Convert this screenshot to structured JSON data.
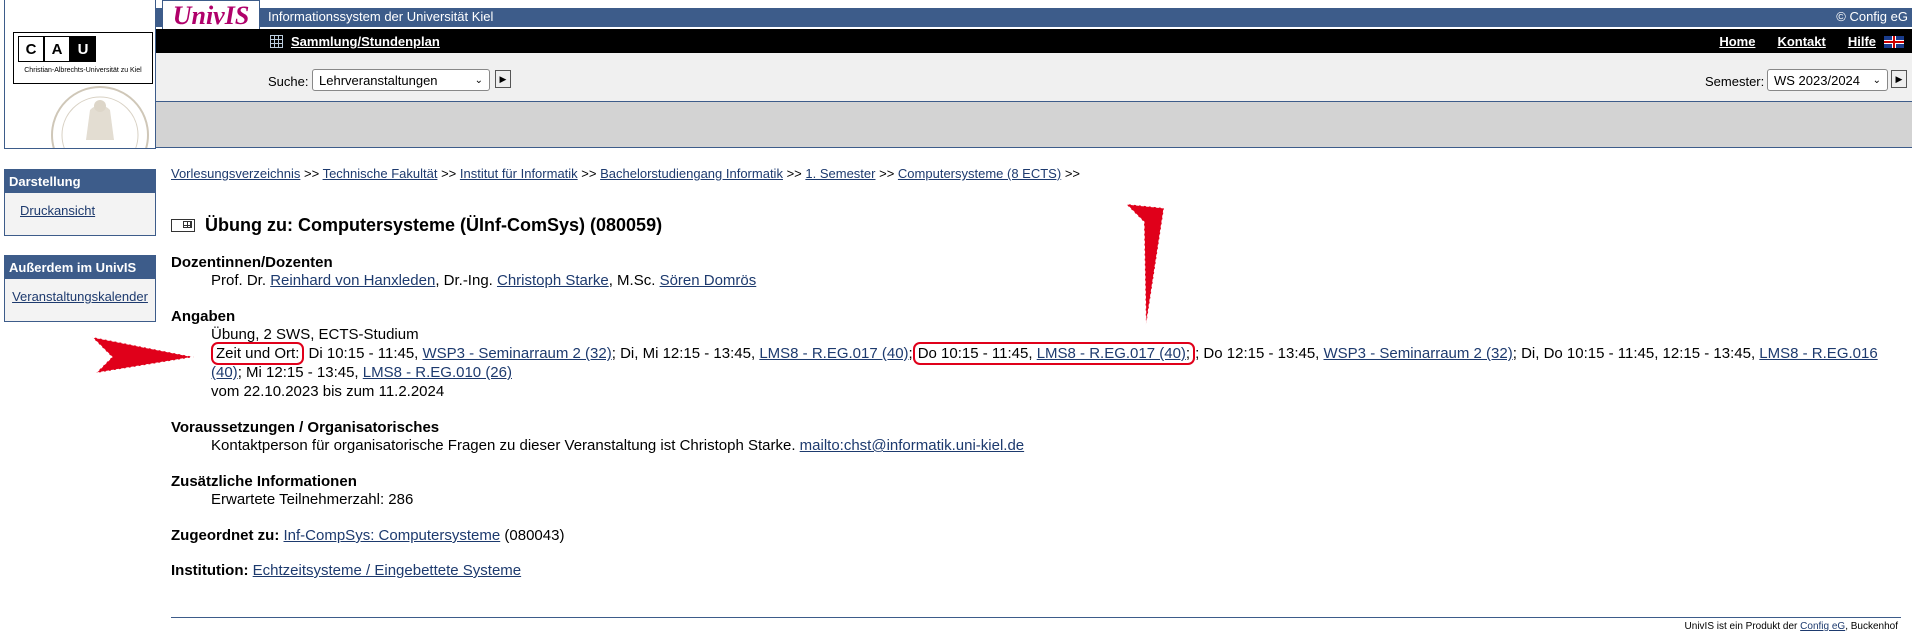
{
  "brand": {
    "logo_letters": [
      "C",
      "A",
      "U"
    ],
    "logo_subtitle": "Christian-Albrechts-Universität zu Kiel",
    "univis": "UnivIS",
    "system_title": "Informationssystem der Universität Kiel",
    "copyright": "© Config eG"
  },
  "nav": {
    "sammlung": "Sammlung/Stundenplan",
    "home": "Home",
    "kontakt": "Kontakt",
    "hilfe": "Hilfe"
  },
  "search": {
    "label": "Suche:",
    "selected": "Lehrveranstaltungen",
    "semester_label": "Semester:",
    "semester_selected": "WS 2023/2024"
  },
  "sidebar": {
    "darstellung_title": "Darstellung",
    "druckansicht": "Druckansicht",
    "ausserdem_title": "Außerdem im UnivIS",
    "kalender": "Veranstaltungskalender"
  },
  "breadcrumb": {
    "items": [
      "Vorlesungsverzeichnis",
      "Technische Fakultät",
      "Institut für Informatik",
      "Bachelorstudiengang Informatik",
      "1. Semester",
      "Computersysteme (8 ECTS)"
    ],
    "sep": ">>"
  },
  "course": {
    "title": "Übung zu: Computersysteme (ÜInf-ComSys) (080059)",
    "dozenten_heading": "Dozentinnen/Dozenten",
    "dozenten": {
      "p1_prefix": "Prof. Dr. ",
      "p1": "Reinhard von Hanxleden",
      "p2_prefix": ", Dr.-Ing. ",
      "p2": "Christoph Starke",
      "p3_prefix": ", M.Sc. ",
      "p3": "Sören Domrös"
    },
    "angaben_heading": "Angaben",
    "angaben_line": "Übung, 2 SWS, ECTS-Studium",
    "zeit_label": "Zeit und Ort:",
    "zeit": {
      "t1": " Di 10:15 - 11:45, ",
      "r1": "WSP3 - Seminarraum 2 (32)",
      "t2": "; Di, Mi 12:15 - 13:45, ",
      "r2": "LMS8 - R.EG.017 (40)",
      "sep": ";",
      "t3": "Do 10:15 - 11:45, ",
      "r3": "LMS8 - R.EG.017 (40)",
      "t4": "; Do 12:15 - 13:45, ",
      "r4": "WSP3 - Seminarraum 2 (32)",
      "t5": "; Di, Do 10:15 - 11:45, 12:15 - 13:45, ",
      "r5": "LMS8 - R.EG.016 (40)",
      "t6": "; Mi 12:15 - 13:45, ",
      "r6": "LMS8 - R.EG.010 (26)"
    },
    "zeitraum": "vom 22.10.2023 bis zum 11.2.2024",
    "voraus_heading": "Voraussetzungen / Organisatorisches",
    "voraus_text": "Kontaktperson für organisatorische Fragen zu dieser Veranstaltung ist Christoph Starke. ",
    "voraus_mail": "mailto:chst@informatik.uni-kiel.de",
    "zusatz_heading": "Zusätzliche Informationen",
    "zusatz_text": "Erwartete Teilnehmerzahl: 286",
    "zugeordnet_label": "Zugeordnet zu:",
    "zugeordnet_link": "Inf-CompSys: Computersysteme",
    "zugeordnet_num": " (080043)",
    "institution_label": "Institution:",
    "institution_link": "Echtzeitsysteme / Eingebettete Systeme"
  },
  "footer": {
    "text": "UnivIS ist ein Produkt der ",
    "link": "Config eG",
    "suffix": ", Buckenhof"
  },
  "colors": {
    "header_blue": "#3d5c8a",
    "highlight_red": "#e0001a",
    "link": "#1d3a6e"
  }
}
